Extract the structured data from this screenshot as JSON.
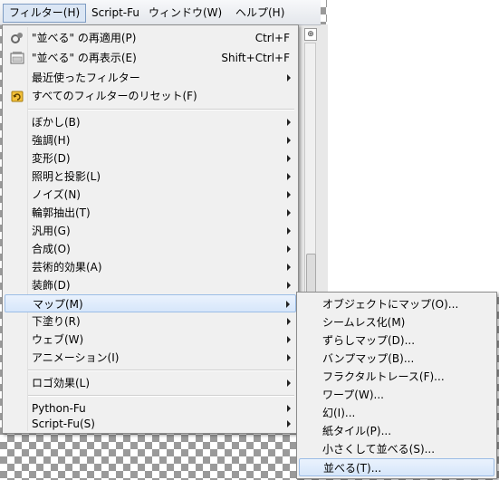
{
  "menubar": {
    "items": [
      {
        "label": "フィルター(H)"
      },
      {
        "label": "Script-Fu"
      },
      {
        "label": "ウィンドウ(W)"
      },
      {
        "label": "ヘルプ(H)"
      }
    ]
  },
  "filters_menu": {
    "reapply": {
      "label": "\"並べる\" の再適用(P)",
      "shortcut": "Ctrl+F"
    },
    "reshow": {
      "label": "\"並べる\" の再表示(E)",
      "shortcut": "Shift+Ctrl+F"
    },
    "recent": {
      "label": "最近使ったフィルター"
    },
    "reset_all": {
      "label": "すべてのフィルターのリセット(F)"
    },
    "categories": [
      {
        "label": "ぼかし(B)"
      },
      {
        "label": "強調(H)"
      },
      {
        "label": "変形(D)"
      },
      {
        "label": "照明と投影(L)"
      },
      {
        "label": "ノイズ(N)"
      },
      {
        "label": "輪郭抽出(T)"
      },
      {
        "label": "汎用(G)"
      },
      {
        "label": "合成(O)"
      },
      {
        "label": "芸術的効果(A)"
      },
      {
        "label": "装飾(D)"
      },
      {
        "label": "マップ(M)"
      },
      {
        "label": "下塗り(R)"
      },
      {
        "label": "ウェブ(W)"
      },
      {
        "label": "アニメーション(I)"
      }
    ],
    "logo": {
      "label": "ロゴ効果(L)"
    },
    "python_fu": {
      "label": "Python-Fu"
    },
    "script_fu": {
      "label": "Script-Fu(S)"
    }
  },
  "map_submenu": {
    "items": [
      {
        "label": "オブジェクトにマップ(O)..."
      },
      {
        "label": "シームレス化(M)"
      },
      {
        "label": "ずらしマップ(D)..."
      },
      {
        "label": "バンプマップ(B)..."
      },
      {
        "label": "フラクタルトレース(F)..."
      },
      {
        "label": "ワープ(W)..."
      },
      {
        "label": "幻(I)..."
      },
      {
        "label": "紙タイル(P)..."
      },
      {
        "label": "小さくして並べる(S)..."
      },
      {
        "label": "並べる(T)..."
      }
    ]
  },
  "canvas": {
    "nav_glyph": "⊕"
  },
  "colors": {
    "highlight": "#d6e6fa",
    "highlight_border": "#9cbde6",
    "menu_bg": "#f0f0f0"
  }
}
